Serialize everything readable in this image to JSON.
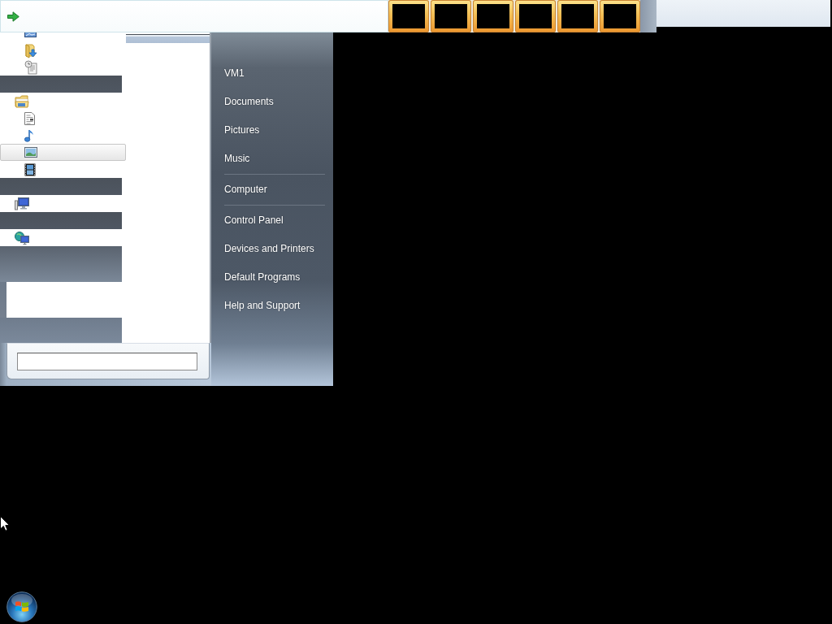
{
  "nav_groups": [
    {
      "children": [
        {
          "selected": false
        },
        {
          "selected": false
        },
        {
          "selected": false
        }
      ]
    },
    {
      "items": [
        {
          "selected": false,
          "children": [
            {
              "selected": false
            },
            {
              "selected": false
            },
            {
              "selected": true
            },
            {
              "selected": false
            }
          ]
        }
      ]
    },
    {
      "items": [
        {
          "selected": false
        }
      ]
    },
    {
      "items": [
        {
          "selected": false
        }
      ]
    }
  ],
  "right_menu": [
    {
      "items": [
        "VM1",
        "Documents",
        "Pictures",
        "Music"
      ]
    },
    {
      "items": [
        "Computer"
      ]
    },
    {
      "items": [
        "Control Panel",
        "Devices and Printers",
        "Default Programs",
        "Help and Support"
      ]
    }
  ]
}
